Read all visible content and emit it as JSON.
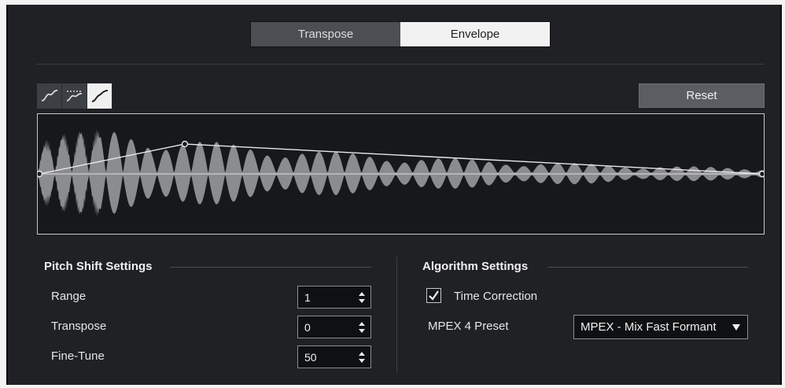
{
  "tabs": [
    {
      "label": "Transpose",
      "active": false
    },
    {
      "label": "Envelope",
      "active": true
    }
  ],
  "envelope": {
    "shape_icons": [
      "spline-curve-icon",
      "damped-curve-icon",
      "linear-curve-icon"
    ],
    "active_shape": 2,
    "reset_label": "Reset"
  },
  "pitch_shift": {
    "title": "Pitch Shift Settings",
    "range": {
      "label": "Range",
      "value": "1"
    },
    "transpose": {
      "label": "Transpose",
      "value": "0"
    },
    "fine_tune": {
      "label": "Fine-Tune",
      "value": "50"
    }
  },
  "algorithm": {
    "title": "Algorithm Settings",
    "time_correction": {
      "label": "Time Correction",
      "checked": true
    },
    "preset": {
      "label": "MPEX 4 Preset",
      "value": "MPEX - Mix Fast Formant"
    }
  },
  "colors": {
    "panel": "#1f2124",
    "active_tab": "#f2f2f2",
    "inactive_tab": "#4b4e53",
    "waveform": "#8a8c90",
    "envelope_line": "#e8e8e8"
  }
}
